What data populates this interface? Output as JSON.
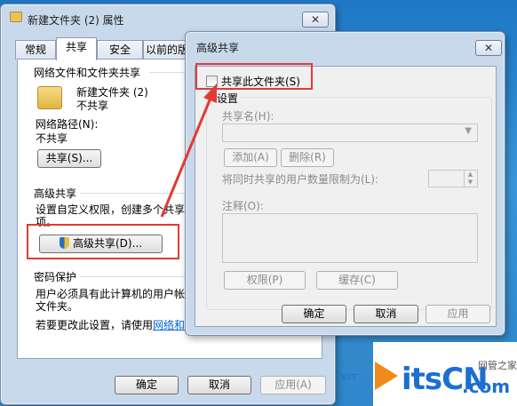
{
  "folder_props": {
    "title": "新建文件夹 (2) 属性",
    "close_label": "✕",
    "tabs": [
      "常规",
      "共享",
      "安全",
      "以前的版"
    ],
    "network_sharing": {
      "header": "网络文件和文件夹共享",
      "folder_name": "新建文件夹 (2)",
      "folder_state": "不共享",
      "path_label": "网络路径(N):",
      "path_value": "不共享",
      "share_button": "共享(S)..."
    },
    "advanced": {
      "header": "高级共享",
      "desc_line1": "设置自定义权限，创建多个共享",
      "desc_line2": "项。",
      "button": "高级共享(D)..."
    },
    "password": {
      "header": "密码保护",
      "line1": "用户必须具有此计算机的用户帐",
      "line2": "文件夹。",
      "line3_prefix": "若要更改此设置，请使用",
      "line3_link": "网络和"
    },
    "buttons": {
      "ok": "确定",
      "cancel": "取消",
      "apply": "应用(A)"
    }
  },
  "adv_share": {
    "title": "高级共享",
    "close_label": "✕",
    "checkbox_label": "共享此文件夹(S)",
    "checkbox_checked": false,
    "settings": {
      "header": "设置",
      "share_name_label": "共享名(H):",
      "add_button": "添加(A)",
      "remove_button": "删除(R)",
      "limit_label": "将同时共享的用户数量限制为(L):",
      "comment_label": "注释(O):",
      "permissions_button": "权限(P)",
      "caching_button": "缓存(C)"
    },
    "buttons": {
      "ok": "确定",
      "cancel": "取消",
      "apply": "应用"
    }
  },
  "watermark": {
    "brand": "itsCN",
    "suffix": ".com",
    "tagline": "网管之家",
    "site_partial": "XIT"
  },
  "colors": {
    "annotation_red": "#e13b34",
    "link": "#0066cc",
    "logo_blue": "#1b6fd0"
  }
}
